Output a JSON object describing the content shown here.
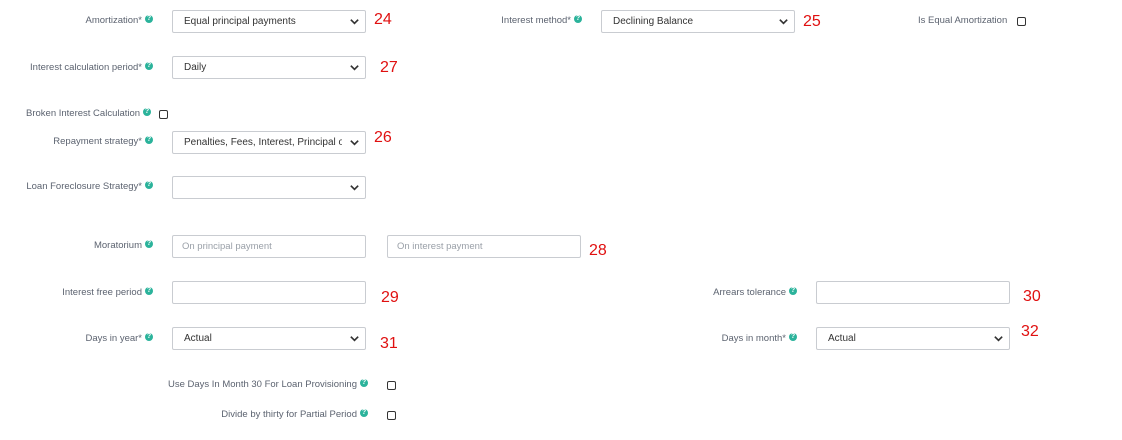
{
  "fields": {
    "amortization": {
      "label": "Amortization*",
      "value": "Equal principal payments",
      "marker": "24"
    },
    "interest_method": {
      "label": "Interest method*",
      "value": "Declining Balance",
      "marker": "25"
    },
    "equal_amortization": {
      "label": "Is Equal Amortization"
    },
    "interest_calc_period": {
      "label": "Interest calculation period*",
      "value": "Daily",
      "marker": "27"
    },
    "broken_interest": {
      "label": "Broken Interest Calculation"
    },
    "repayment_strategy": {
      "label": "Repayment strategy*",
      "value": "Penalties, Fees, Interest, Principal ord",
      "marker": "26"
    },
    "loan_foreclosure": {
      "label": "Loan Foreclosure Strategy*",
      "value": ""
    },
    "moratorium": {
      "label": "Moratorium",
      "principal_placeholder": "On principal payment",
      "interest_placeholder": "On interest payment",
      "marker": "28"
    },
    "interest_free_period": {
      "label": "Interest free period",
      "value": "",
      "marker": "29"
    },
    "arrears_tolerance": {
      "label": "Arrears tolerance",
      "value": "",
      "marker": "30"
    },
    "days_in_year": {
      "label": "Days in year*",
      "value": "Actual",
      "marker": "31"
    },
    "days_in_month": {
      "label": "Days in month*",
      "value": "Actual",
      "marker": "32"
    },
    "days_in_month_30": {
      "label": "Use Days In Month 30 For Loan Provisioning"
    },
    "divide_by_thirty": {
      "label": "Divide by thirty for Partial Period"
    }
  },
  "icons": {
    "help": "question-circle-icon",
    "dropdown": "chevron-down-icon"
  },
  "colors": {
    "help_icon": "#2bb39b",
    "marker": "#e01010",
    "border": "#c9ccd1"
  }
}
